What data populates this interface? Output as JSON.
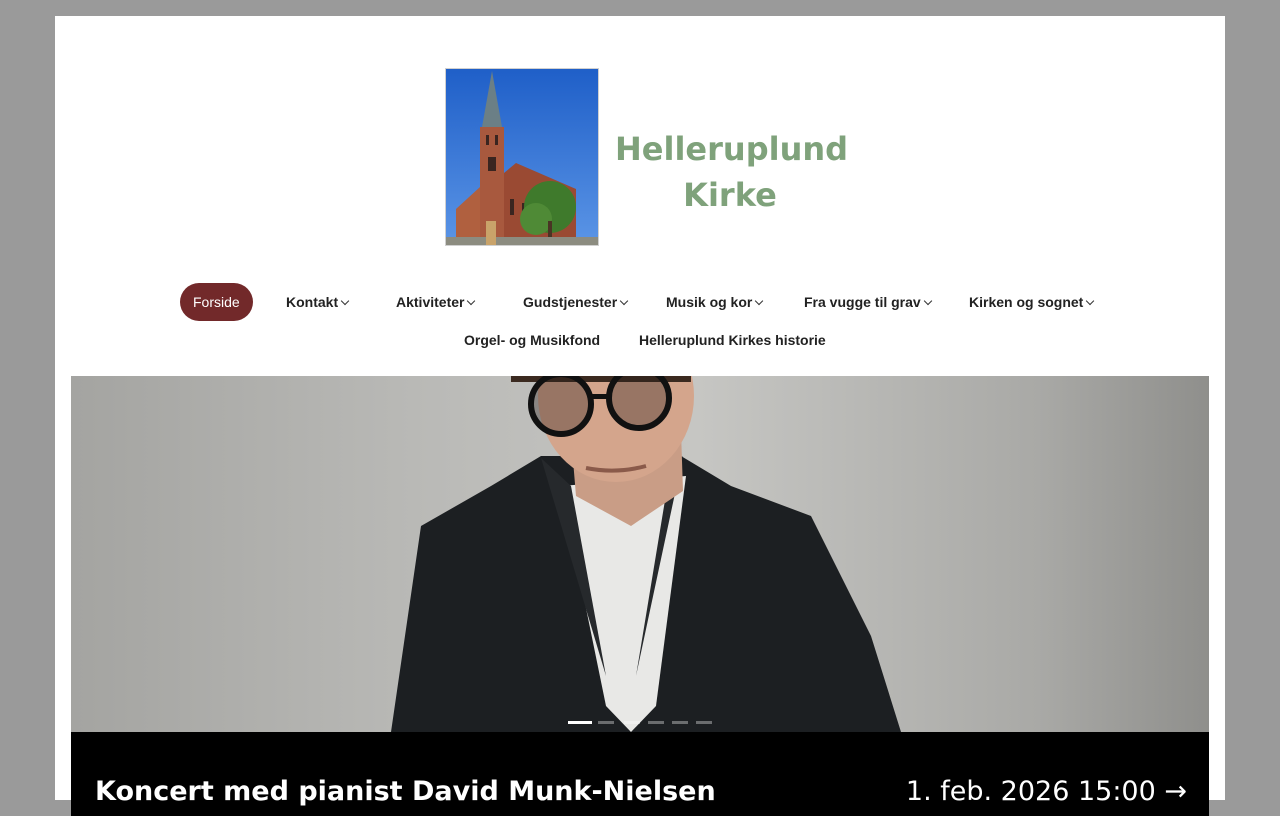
{
  "site": {
    "logo_text_line1": "Helleruplund",
    "logo_text_line2": "Kirke",
    "logo_color": "#7fa27b"
  },
  "nav": {
    "active_color": "#72292a",
    "row1": [
      {
        "label": "Forside",
        "active": true,
        "dropdown": false
      },
      {
        "label": "Kontakt",
        "active": false,
        "dropdown": true
      },
      {
        "label": "Aktiviteter",
        "active": false,
        "dropdown": true
      },
      {
        "label": "Gudstjenester",
        "active": false,
        "dropdown": true
      },
      {
        "label": "Musik og kor",
        "active": false,
        "dropdown": true
      },
      {
        "label": "Fra vugge til grav",
        "active": false,
        "dropdown": true
      },
      {
        "label": "Kirken og sognet",
        "active": false,
        "dropdown": true
      }
    ],
    "row2": [
      {
        "label": "Orgel- og Musikfond",
        "active": false,
        "dropdown": false
      },
      {
        "label": "Helleruplund Kirkes historie",
        "active": false,
        "dropdown": false
      }
    ]
  },
  "slider": {
    "dots_total": 6,
    "active_index": 0
  },
  "event": {
    "title": "Koncert med pianist David Munk-Nielsen",
    "date": "1. feb. 2026 15:00 →"
  }
}
